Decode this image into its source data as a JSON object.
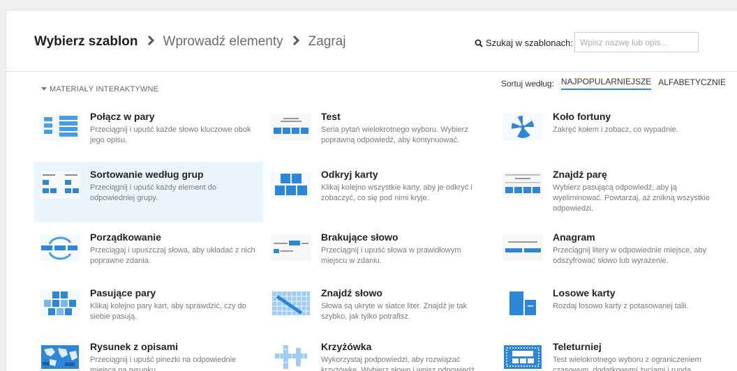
{
  "breadcrumb": {
    "step1": "Wybierz szablon",
    "step2": "Wprowadź elementy",
    "step3": "Zagraj"
  },
  "search": {
    "label": "Szukaj w szablonach:",
    "placeholder": "Wpisz nazwę lub opis..."
  },
  "section": {
    "label": "MATERIAŁY INTERAKTYWNE"
  },
  "sort": {
    "label": "Sortuj według:",
    "option1": "NAJPOPULARNIEJSZE",
    "option2": "ALFABETYCZNIE"
  },
  "templates": [
    {
      "title": "Połącz w pary",
      "desc": "Przeciągnij i upuść każde słowo kluczowe obok jego opisu.",
      "icon": "match-pairs-icon"
    },
    {
      "title": "Test",
      "desc": "Seria pytań wielokrotnego wyboru. Wybierz poprawną odpowiedź, aby kontynuować.",
      "icon": "quiz-icon"
    },
    {
      "title": "Koło fortuny",
      "desc": "Zakręć kołem i zobacz, co wypadnie.",
      "icon": "wheel-icon"
    },
    {
      "title": "Sortowanie według grup",
      "desc": "Przeciągnij i upuść każdy element do odpowiedniej grupy.",
      "icon": "group-sort-icon"
    },
    {
      "title": "Odkryj karty",
      "desc": "Klikaj kolejno wszystkie karty, aby je odkryć i zobaczyć, co się pod nimi kryje.",
      "icon": "open-box-icon"
    },
    {
      "title": "Znajdź parę",
      "desc": "Wybierz pasującą odpowiedź, aby ją wyeliminować. Powtarzaj, aż znikną wszystkie odpowiedzi.",
      "icon": "find-match-icon"
    },
    {
      "title": "Porządkowanie",
      "desc": "Przeciągaj i upuszczaj słowa, aby układać z nich poprawne zdania.",
      "icon": "unjumble-icon"
    },
    {
      "title": "Brakujące słowo",
      "desc": "Przeciągnij i upuść słowa w prawidłowym miejscu w zdaniu.",
      "icon": "missing-word-icon"
    },
    {
      "title": "Anagram",
      "desc": "Przeciągnij litery w odpowiednie miejsce, aby odszyfrować słowo lub wyrażenie.",
      "icon": "anagram-icon"
    },
    {
      "title": "Pasujące pary",
      "desc": "Klikaj kolejno pary kart, aby sprawdzić, czy do siebie pasują.",
      "icon": "matching-pairs-icon"
    },
    {
      "title": "Znajdź słowo",
      "desc": "Słowa są ukryte w siatce liter. Znajdź je tak szybko, jak tylko potrafisz.",
      "icon": "wordsearch-icon"
    },
    {
      "title": "Losowe karty",
      "desc": "Rozdaj losowo karty z potasowanej talii.",
      "icon": "random-cards-icon"
    },
    {
      "title": "Rysunek z opisami",
      "desc": "Przeciągnij i upuść pinezki na odpowiednie miejsca na rysunku.",
      "icon": "labelled-diagram-icon"
    },
    {
      "title": "Krzyżówka",
      "desc": "Wykorzystaj podpowiedzi, aby rozwiązać krzyżówkę. Wybierz słowo i wpisz odpowiedź.",
      "icon": "crossword-icon"
    },
    {
      "title": "Teleturniej",
      "desc": "Test wielokrotnego wyboru z ograniczeniem czasowym, dodatkowymi życiami i rundą",
      "icon": "gameshow-icon"
    }
  ]
}
